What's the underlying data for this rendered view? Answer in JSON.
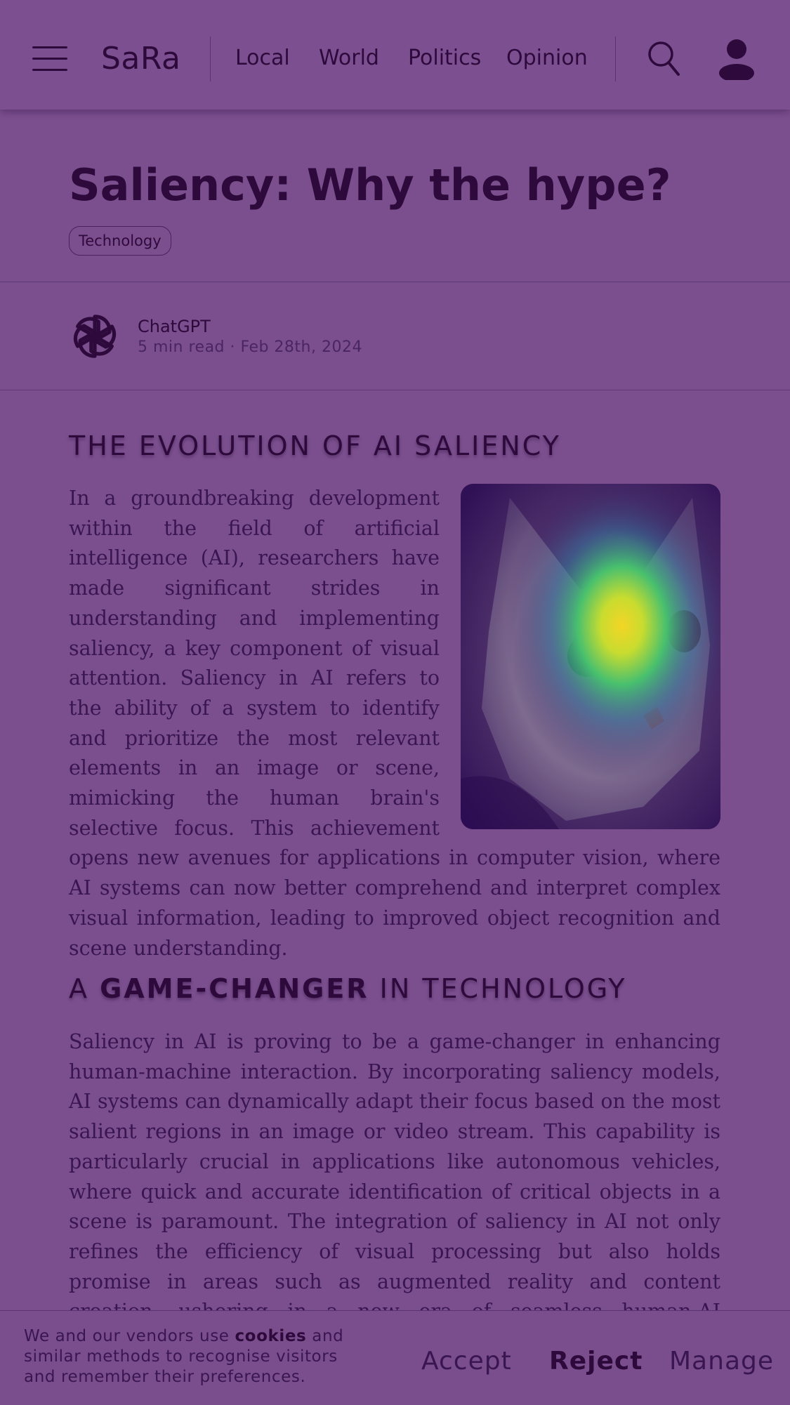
{
  "header": {
    "brand": "SaRa",
    "nav": [
      "Local",
      "World",
      "Politics",
      "Opinion"
    ],
    "icons": [
      "menu-icon",
      "search-icon",
      "user-icon"
    ]
  },
  "article": {
    "title": "Saliency: Why the hype?",
    "tag": "Technology",
    "author": {
      "name": "ChatGPT",
      "meta": "5 min read · Feb 28th, 2024",
      "logo": "openai-logo"
    },
    "sections": [
      {
        "heading_pre": "THE EVOLUTION OF AI SALIENCY",
        "heading_bold": "",
        "heading_post": "",
        "paragraph": "In a groundbreaking development within the field of artificial intelligence (AI), researchers have made significant strides in understanding and implementing saliency, a key component of visual attention. Saliency in AI refers to the ability of a system to identify and prioritize the most relevant elements in an image or scene, mimicking the human brain's selective focus. This achievement opens new avenues for applications in computer vision, where AI systems can now better comprehend and interpret complex visual information, leading to improved object recognition and scene understanding."
      },
      {
        "heading_pre": "A ",
        "heading_bold": "GAME-CHANGER",
        "heading_post": " IN TECHNOLOGY",
        "paragraph": "Saliency in AI is proving to be a game-changer in enhancing human-machine interaction. By incorporating saliency models, AI systems can dynamically adapt their focus based on the most salient regions in an image or video stream. This capability is particularly crucial in applications like autonomous vehicles, where quick and accurate identification of critical objects in a scene is paramount. The integration of saliency in AI not only refines the efficiency of visual processing but also holds promise in areas such as augmented reality and content creation, ushering in a new era of seamless human-AI collaboration."
      }
    ]
  },
  "cookie_banner": {
    "text_before": "We and our vendors use ",
    "text_bold": "cookies",
    "text_after": " and similar methods to recognise visitors and remember their preferences.",
    "accept": "Accept",
    "reject": "Reject",
    "manage": "Manage"
  },
  "colors": {
    "overlay_purple": "#7b4f8e",
    "text_dark": "#2e0a3c",
    "saliency_peak": "#f3d526"
  }
}
